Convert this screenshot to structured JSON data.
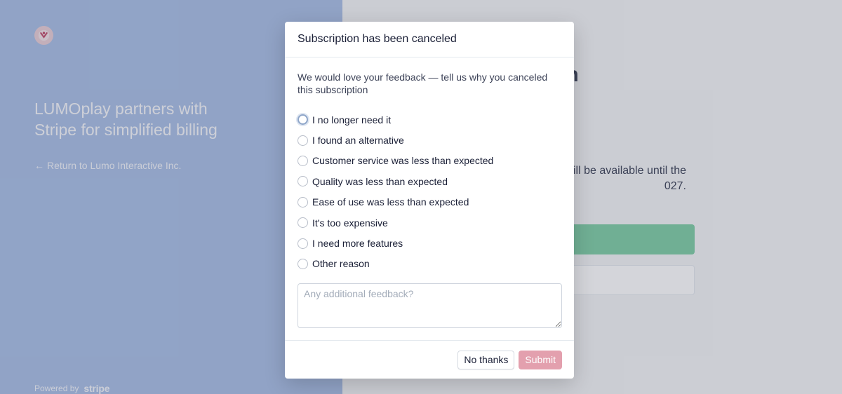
{
  "brand": {
    "logo_icon": "lumo-logo-icon",
    "title": "LUMOplay partners with Stripe for simplified billing",
    "return_link": "Return to Lumo Interactive Inc.",
    "powered_by": "Powered by",
    "powered_brand": "stripe"
  },
  "background_page": {
    "heading_fragment": "on",
    "text_fragment": "ill be available until the 027."
  },
  "modal": {
    "title": "Subscription has been canceled",
    "description": "We would love your feedback — tell us why you canceled this subscription",
    "options": [
      "I no longer need it",
      "I found an alternative",
      "Customer service was less than expected",
      "Quality was less than expected",
      "Ease of use was less than expected",
      "It's too expensive",
      "I need more features",
      "Other reason"
    ],
    "feedback_placeholder": "Any additional feedback?",
    "no_thanks_label": "No thanks",
    "submit_label": "Submit"
  },
  "colors": {
    "brand_panel": "#a9bfe6",
    "accent_button": "#e3a0ae",
    "success_button": "#7fcfa6"
  }
}
